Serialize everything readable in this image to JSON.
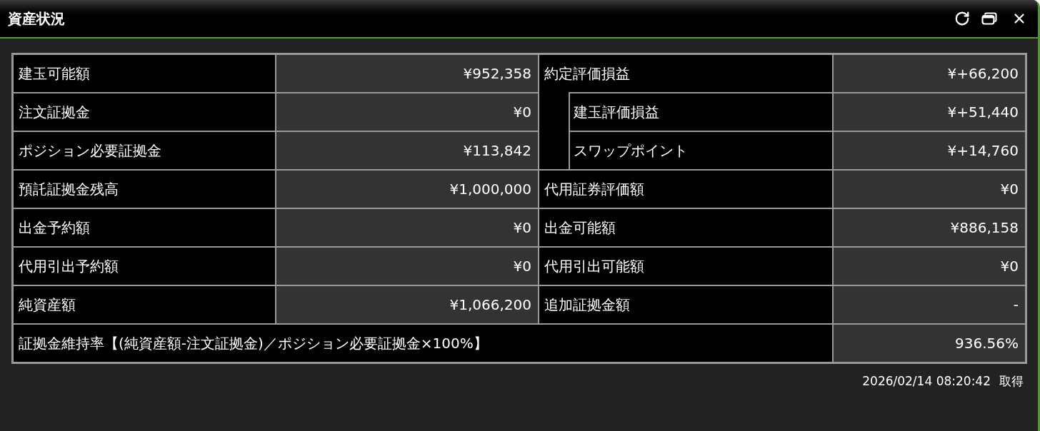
{
  "window": {
    "title": "資産状況"
  },
  "left_column": [
    {
      "label": "建玉可能額",
      "value": "¥952,358"
    },
    {
      "label": "注文証拠金",
      "value": "¥0"
    },
    {
      "label": "ポジション必要証拠金",
      "value": "¥113,842"
    },
    {
      "label": "預託証拠金残高",
      "value": "¥1,000,000"
    },
    {
      "label": "出金予約額",
      "value": "¥0"
    },
    {
      "label": "代用引出予約額",
      "value": "¥0"
    },
    {
      "label": "純資産額",
      "value": "¥1,066,200"
    }
  ],
  "right_column": [
    {
      "label": "約定評価損益",
      "value": "¥+66,200",
      "children": [
        {
          "label": "建玉評価損益",
          "value": "¥+51,440"
        },
        {
          "label": "スワップポイント",
          "value": "¥+14,760"
        }
      ]
    },
    {
      "label": "代用証券評価額",
      "value": "¥0"
    },
    {
      "label": "出金可能額",
      "value": "¥886,158"
    },
    {
      "label": "代用引出可能額",
      "value": "¥0"
    },
    {
      "label": "追加証拠金額",
      "value": "-"
    }
  ],
  "margin_ratio_row": {
    "label": "証拠金維持率【(純資産額-注文証拠金)／ポジション必要証拠金×100%】",
    "value": "936.56%"
  },
  "footer": {
    "timestamp": "2026/02/14 08:20:42",
    "action": "取得"
  }
}
